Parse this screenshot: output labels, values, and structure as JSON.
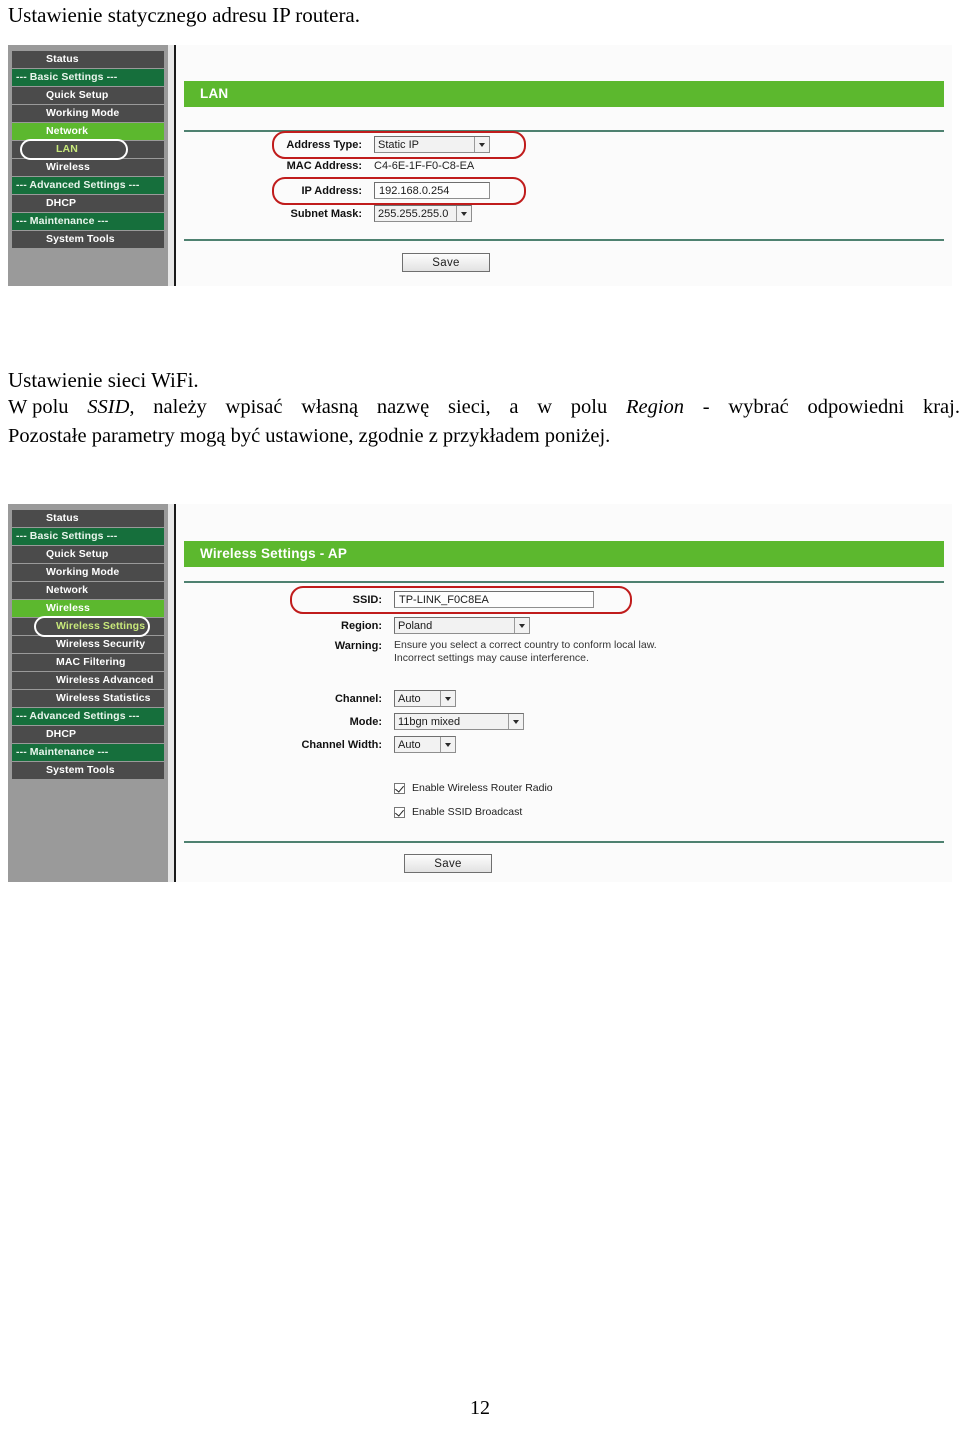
{
  "document": {
    "heading": "Ustawienie statycznego adresu IP routera.",
    "section2_heading": "Ustawienie sieci WiFi.",
    "paragraph_line1_a": "W polu",
    "paragraph_line1_ssid": "SSID,",
    "paragraph_line1_b": "należy",
    "paragraph_line1_c": "wpisać",
    "paragraph_line1_d": "własną",
    "paragraph_line1_e": "nazwę",
    "paragraph_line1_f": "sieci,",
    "paragraph_line1_g": "a",
    "paragraph_line1_h": "w",
    "paragraph_line1_i": "polu",
    "paragraph_line1_region": "Region",
    "paragraph_line1_j": "-",
    "paragraph_line1_k": "wybrać",
    "paragraph_line1_l": "odpowiedni",
    "paragraph_line1_m": "kraj.",
    "paragraph_line2": "Pozostałe parametry mogą być ustawione, zgodnie z przykładem poniżej.",
    "page_number": "12"
  },
  "colors": {
    "accent_green": "#5cb82e",
    "section_green": "#166f3c",
    "menu_gray": "#4b4b4b",
    "sidebar_bg": "#9a9a9a",
    "highlight_red": "#c01c1c",
    "selected_text": "#c8e87a"
  },
  "lan_screen": {
    "sidebar": [
      {
        "label": "Status",
        "type": "item"
      },
      {
        "label": "--- Basic Settings ---",
        "type": "section"
      },
      {
        "label": "Quick Setup",
        "type": "item"
      },
      {
        "label": "Working Mode",
        "type": "item"
      },
      {
        "label": "Network",
        "type": "active"
      },
      {
        "label": "LAN",
        "type": "selected"
      },
      {
        "label": "Wireless",
        "type": "item"
      },
      {
        "label": "--- Advanced Settings ---",
        "type": "section"
      },
      {
        "label": "DHCP",
        "type": "item"
      },
      {
        "label": "--- Maintenance ---",
        "type": "section"
      },
      {
        "label": "System Tools",
        "type": "item"
      }
    ],
    "title": "LAN",
    "fields": {
      "address_type_label": "Address Type:",
      "address_type_value": "Static IP",
      "mac_address_label": "MAC Address:",
      "mac_address_value": "C4-6E-1F-F0-C8-EA",
      "ip_address_label": "IP Address:",
      "ip_address_value": "192.168.0.254",
      "subnet_mask_label": "Subnet Mask:",
      "subnet_mask_value": "255.255.255.0"
    },
    "save_label": "Save"
  },
  "wireless_screen": {
    "sidebar": [
      {
        "label": "Status",
        "type": "item"
      },
      {
        "label": "--- Basic Settings ---",
        "type": "section"
      },
      {
        "label": "Quick Setup",
        "type": "item"
      },
      {
        "label": "Working Mode",
        "type": "item"
      },
      {
        "label": "Network",
        "type": "item"
      },
      {
        "label": "Wireless",
        "type": "active"
      },
      {
        "label": "Wireless Settings",
        "type": "selected"
      },
      {
        "label": "Wireless Security",
        "type": "sub"
      },
      {
        "label": "MAC Filtering",
        "type": "sub"
      },
      {
        "label": "Wireless Advanced",
        "type": "sub"
      },
      {
        "label": "Wireless Statistics",
        "type": "sub"
      },
      {
        "label": "--- Advanced Settings ---",
        "type": "section"
      },
      {
        "label": "DHCP",
        "type": "item"
      },
      {
        "label": "--- Maintenance ---",
        "type": "section"
      },
      {
        "label": "System Tools",
        "type": "item"
      }
    ],
    "title": "Wireless Settings - AP",
    "fields": {
      "ssid_label": "SSID:",
      "ssid_value": "TP-LINK_F0C8EA",
      "region_label": "Region:",
      "region_value": "Poland",
      "warning_label": "Warning:",
      "warning_line1": "Ensure you select a correct country to conform local law.",
      "warning_line2": "Incorrect settings may cause interference.",
      "channel_label": "Channel:",
      "channel_value": "Auto",
      "mode_label": "Mode:",
      "mode_value": "11bgn mixed",
      "channel_width_label": "Channel Width:",
      "channel_width_value": "Auto"
    },
    "checkboxes": [
      {
        "label": "Enable Wireless Router Radio",
        "checked": true
      },
      {
        "label": "Enable SSID Broadcast",
        "checked": true
      }
    ],
    "save_label": "Save"
  }
}
